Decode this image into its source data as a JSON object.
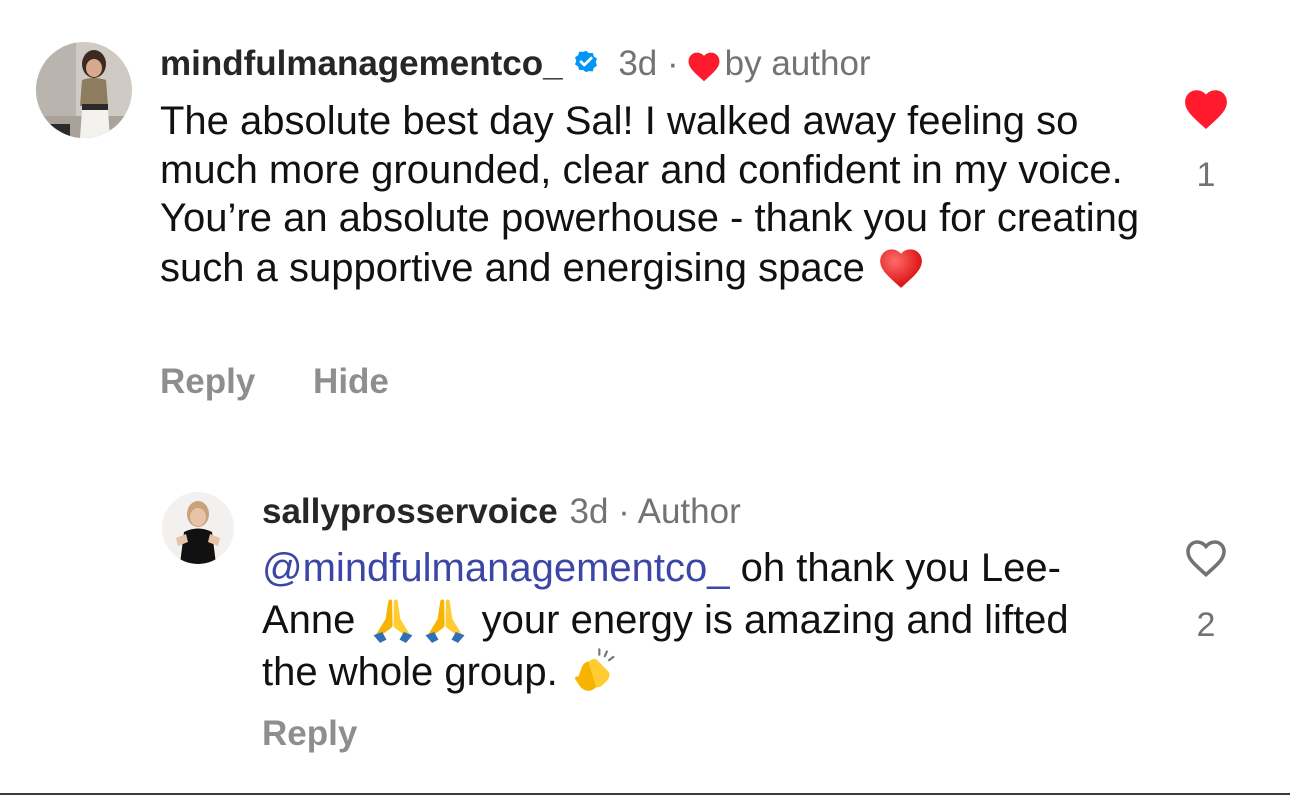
{
  "comments": [
    {
      "username": "mindfulmanagementco_",
      "verified": true,
      "time": "3d",
      "separator": "·",
      "liked_by_author_label": "by author",
      "text": "The absolute best day Sal! I walked away feeling so much more grounded, clear and confident in my voice. You’re an absolute powerhouse - thank you for creating such a supportive and energising space",
      "text_emoji": "red-heart",
      "actions": {
        "reply": "Reply",
        "hide": "Hide"
      },
      "like_count": "1",
      "liked": true
    },
    {
      "username": "sallyprosservoice",
      "time": "3d",
      "separator": "·",
      "author_badge": "Author",
      "mention": "@mindfulmanagementco_",
      "text_part1": "oh thank you Lee-Anne",
      "emoji_1": "folded-hands",
      "emoji_2": "folded-hands",
      "text_part2": "your energy is amazing and lifted the whole group.",
      "emoji_3": "clapping-hands",
      "actions": {
        "reply": "Reply"
      },
      "like_count": "2",
      "liked": false
    }
  ],
  "colors": {
    "heart_red": "#ff3040",
    "verified_blue": "#0095f6",
    "mention_blue": "#3b46a6",
    "muted_text": "#737373"
  }
}
